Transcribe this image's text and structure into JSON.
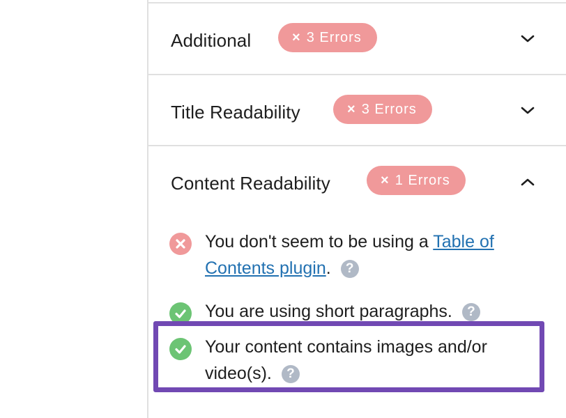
{
  "colors": {
    "badge_error": "#f0999a",
    "status_fail": "#f0999a",
    "status_pass": "#6cc474",
    "help_icon": "#b0b9c6",
    "link": "#2271b1",
    "highlight": "#7149b3",
    "divider": "#e0e0e0"
  },
  "sections": [
    {
      "title": "Additional",
      "badge": {
        "icon": "x-icon",
        "glyph": "×",
        "label": "3 Errors"
      },
      "expanded": false,
      "toggle_icon": "chevron-down-icon"
    },
    {
      "title": "Title Readability",
      "badge": {
        "icon": "x-icon",
        "glyph": "×",
        "label": "3 Errors"
      },
      "expanded": false,
      "toggle_icon": "chevron-down-icon"
    },
    {
      "title": "Content Readability",
      "badge": {
        "icon": "x-icon",
        "glyph": "×",
        "label": "1 Errors"
      },
      "expanded": true,
      "toggle_icon": "chevron-up-icon",
      "checks": [
        {
          "status": "fail",
          "status_icon": "x-circle-icon",
          "text_before": "You don't seem to be using a ",
          "link_text": "Table of Contents plugin",
          "text_after": ".",
          "help_glyph": "?"
        },
        {
          "status": "pass",
          "status_icon": "check-circle-icon",
          "text": "You are using short paragraphs.",
          "help_glyph": "?"
        },
        {
          "status": "pass",
          "status_icon": "check-circle-icon",
          "text": "Your content contains images and/or video(s).",
          "help_glyph": "?",
          "highlighted": true
        }
      ]
    }
  ]
}
